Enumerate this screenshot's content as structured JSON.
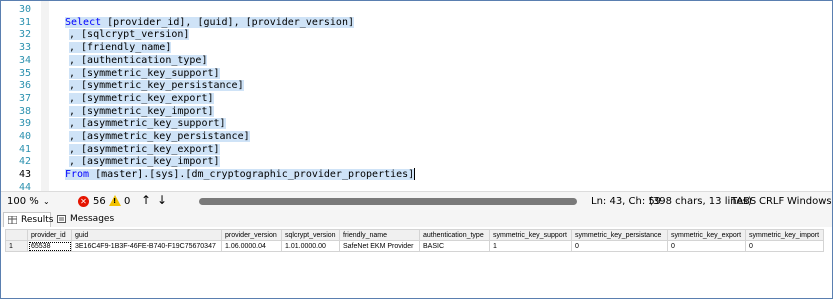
{
  "editor": {
    "lines": [
      {
        "num": "30",
        "text": "",
        "selected": false
      },
      {
        "num": "31",
        "text": "",
        "selected": true,
        "kw_prefix": "Select",
        "rest": " [provider_id], [guid], [provider_version]"
      },
      {
        "num": "32",
        "text": ", [sqlcrypt_version]",
        "selected": true,
        "gray_comma": true
      },
      {
        "num": "33",
        "text": ", [friendly_name]",
        "selected": true,
        "gray_comma": true
      },
      {
        "num": "34",
        "text": ", [authentication_type]",
        "selected": true,
        "gray_comma": true
      },
      {
        "num": "35",
        "text": ", [symmetric_key_support]",
        "selected": true,
        "gray_comma": true
      },
      {
        "num": "36",
        "text": ", [symmetric_key_persistance]",
        "selected": true,
        "gray_comma": true
      },
      {
        "num": "37",
        "text": ", [symmetric_key_export]",
        "selected": true,
        "gray_comma": true
      },
      {
        "num": "38",
        "text": ", [symmetric_key_import]",
        "selected": true,
        "gray_comma": true
      },
      {
        "num": "39",
        "text": ", [asymmetric_key_support]",
        "selected": true,
        "gray_comma": true
      },
      {
        "num": "40",
        "text": ", [asymmetric_key_persistance]",
        "selected": true,
        "gray_comma": true
      },
      {
        "num": "41",
        "text": ", [asymmetric_key_export]",
        "selected": true,
        "gray_comma": true
      },
      {
        "num": "42",
        "text": ", [asymmetric_key_import]",
        "selected": true,
        "gray_comma": true
      },
      {
        "num": "43",
        "text": "",
        "selected": true,
        "kw_prefix": "From",
        "rest": " [master].[sys].[dm_cryptographic_provider_properties]",
        "current": true
      },
      {
        "num": "44",
        "text": "",
        "selected": false
      }
    ]
  },
  "statusbar": {
    "zoom": "100 %",
    "errors": "56",
    "warnings": "0",
    "position": "Ln: 43, Ch: 59",
    "chars": "(398 chars, 13 lines)",
    "tabs": "TABS",
    "line_ending": "CRLF",
    "encoding": "Windows 1"
  },
  "tabs": {
    "results": "Results",
    "messages": "Messages"
  },
  "grid": {
    "columns": [
      "provider_id",
      "guid",
      "provider_version",
      "sqlcrypt_version",
      "friendly_name",
      "authentication_type",
      "symmetric_key_support",
      "symmetric_key_persistance",
      "symmetric_key_export",
      "symmetric_key_import"
    ],
    "rows": [
      {
        "rownum": "1",
        "cells": [
          "65538",
          "3E16C4F9-1B3F-46FE-B740-F19C75670347",
          "1.06.0000.04",
          "1.01.0000.00",
          "SafeNet EKM Provider",
          "BASIC",
          "1",
          "0",
          "0",
          "0"
        ]
      }
    ]
  },
  "colors": {
    "keyword": "#0000ff",
    "line_number": "#2b91af",
    "selection": "#cfe3f7",
    "error": "#e51400",
    "warning": "#f2c200"
  }
}
